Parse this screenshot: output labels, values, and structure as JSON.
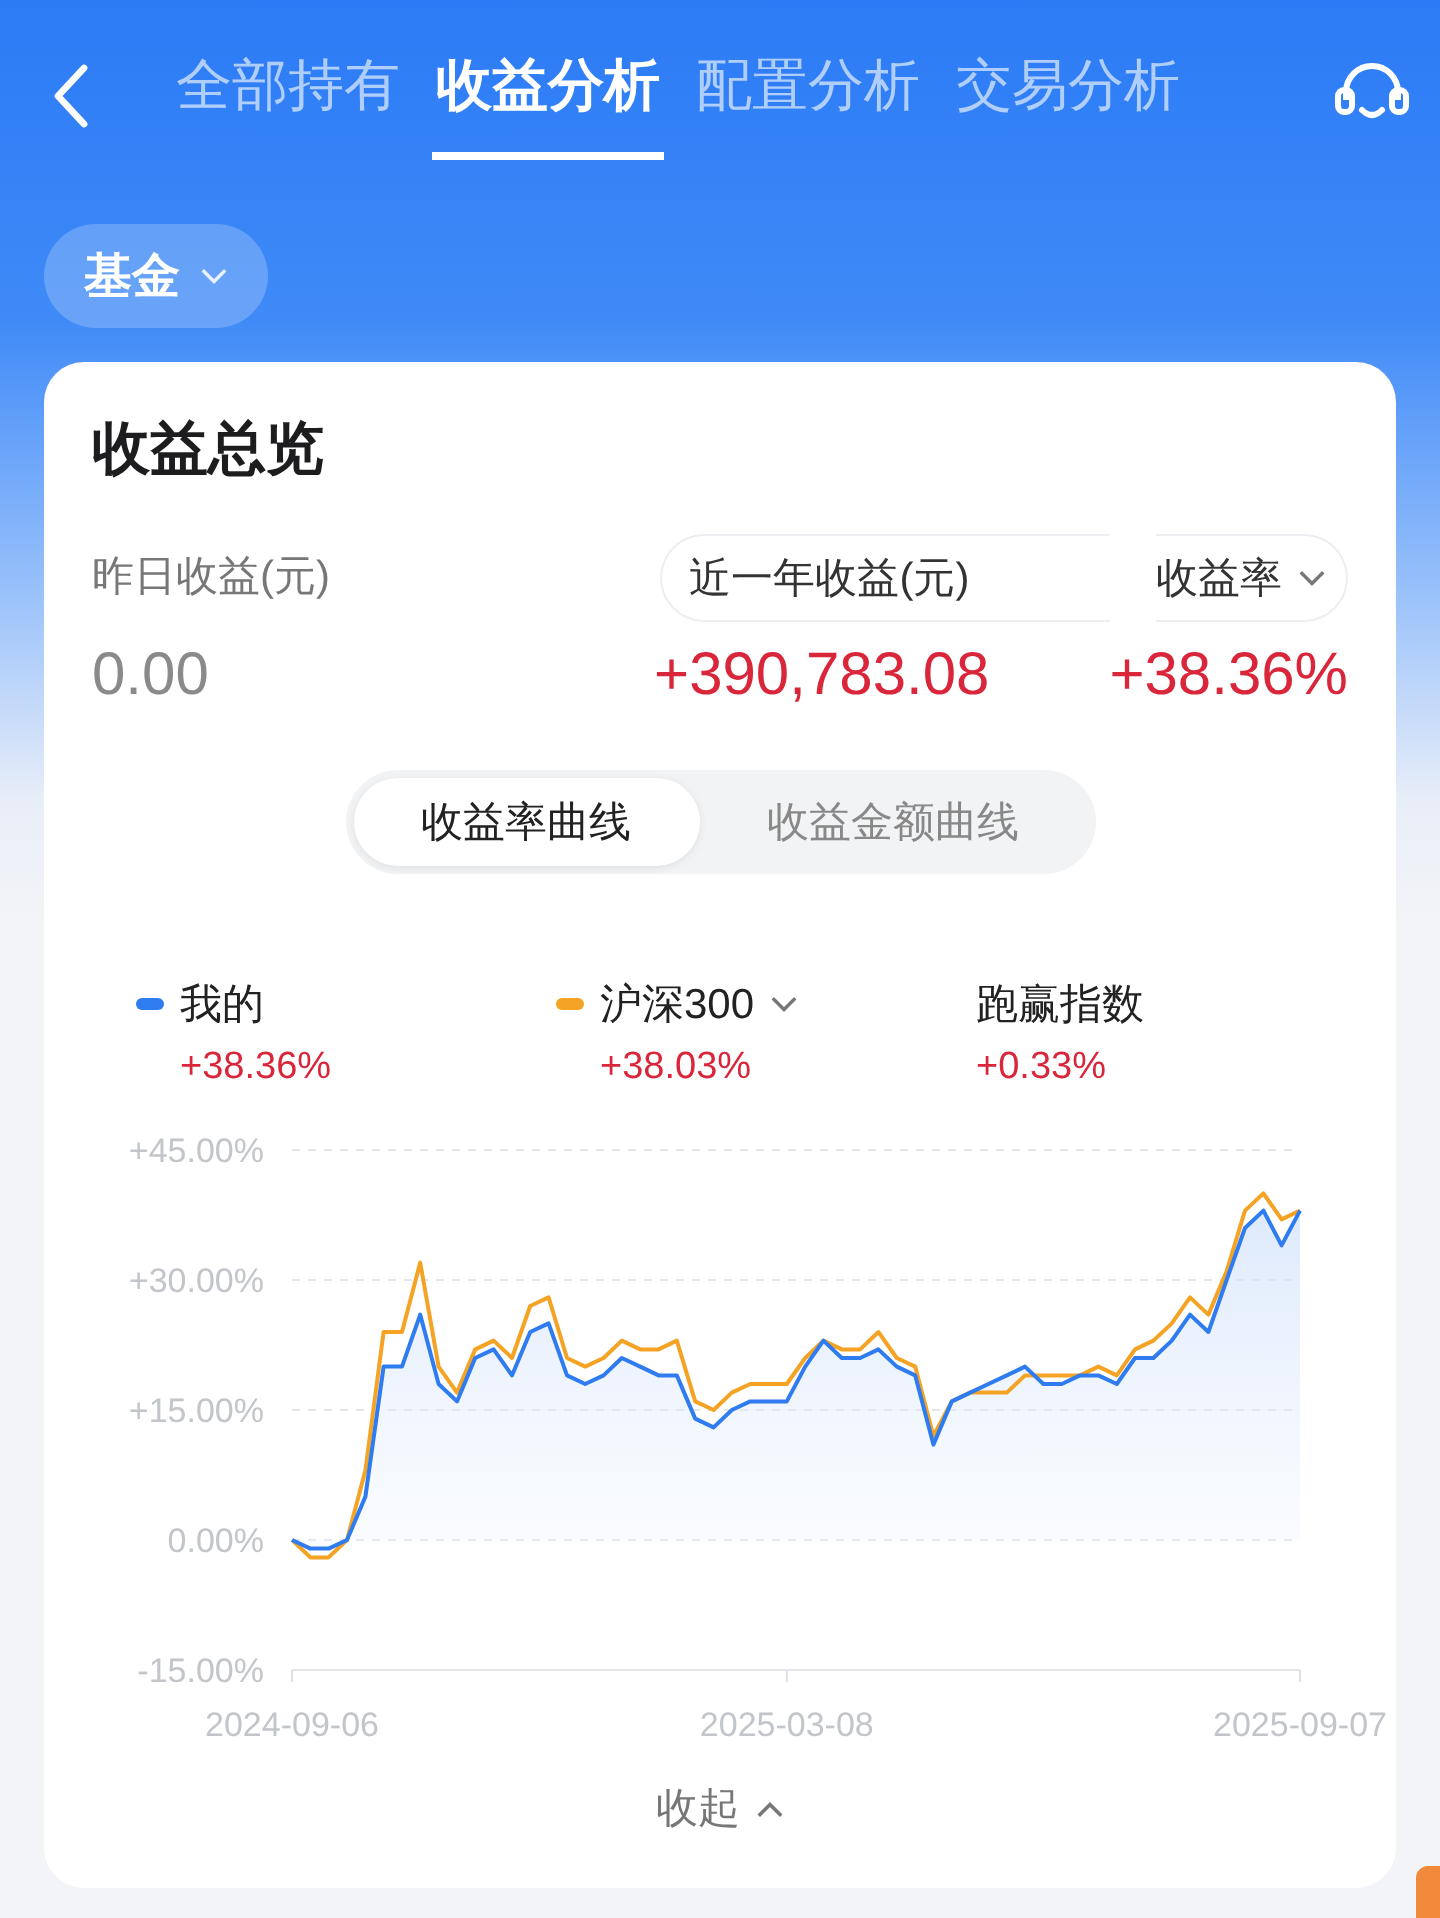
{
  "header": {
    "tabs": [
      {
        "label": "全部持有",
        "selected": false
      },
      {
        "label": "收益分析",
        "selected": true
      },
      {
        "label": "配置分析",
        "selected": false
      },
      {
        "label": "交易分析",
        "selected": false
      }
    ]
  },
  "filter": {
    "label": "基金"
  },
  "overview": {
    "title": "收益总览",
    "stats": [
      {
        "label": "昨日收益(元)",
        "value": "0.00",
        "kind": "plain"
      },
      {
        "label": "近一年收益(元)",
        "value": "+390,783.08",
        "kind": "period"
      },
      {
        "label": "收益率",
        "value": "+38.36%",
        "kind": "dropdown"
      }
    ]
  },
  "curve_tabs": [
    {
      "label": "收益率曲线",
      "selected": true
    },
    {
      "label": "收益金额曲线",
      "selected": false
    }
  ],
  "legend": [
    {
      "value": "+38.36%",
      "kind": "series"
    },
    {
      "value": "+38.03%",
      "kind": "dropdown"
    },
    {
      "name": "跑赢指数",
      "value": "+0.33%",
      "kind": "plain"
    }
  ],
  "chart": {
    "chart_data": {
      "type": "line",
      "grid": true,
      "categories": [
        "2024-09-06",
        null,
        null,
        null,
        null,
        null,
        null,
        null,
        null,
        null,
        null,
        null,
        null,
        null,
        null,
        null,
        null,
        null,
        null,
        null,
        null,
        null,
        null,
        null,
        null,
        null,
        null,
        "2025-03-08",
        null,
        null,
        null,
        null,
        null,
        null,
        null,
        null,
        null,
        null,
        null,
        null,
        null,
        null,
        null,
        null,
        null,
        null,
        null,
        null,
        null,
        null,
        null,
        null,
        null,
        null,
        null,
        "2025-09-07"
      ],
      "series": [
        {
          "name": "我的",
          "type": "area",
          "color": "#2f7cf0",
          "values": [
            0,
            -1,
            -1,
            0,
            5,
            20,
            20,
            26,
            18,
            16,
            21,
            22,
            19,
            24,
            25,
            19,
            18,
            19,
            21,
            20,
            19,
            19,
            14,
            13,
            15,
            16,
            16,
            16,
            20,
            23,
            21,
            21,
            22,
            20,
            19,
            11,
            16,
            17,
            18,
            19,
            20,
            18,
            18,
            19,
            19,
            18,
            21,
            21,
            23,
            26,
            24,
            30,
            36,
            38,
            34,
            38
          ]
        },
        {
          "name": "沪深300",
          "type": "line",
          "color": "#f5a325",
          "values": [
            0,
            -2,
            -2,
            0,
            8,
            24,
            24,
            32,
            20,
            17,
            22,
            23,
            21,
            27,
            28,
            21,
            20,
            21,
            23,
            22,
            22,
            23,
            16,
            15,
            17,
            18,
            18,
            18,
            21,
            23,
            22,
            22,
            24,
            21,
            20,
            12,
            16,
            17,
            17,
            17,
            19,
            19,
            19,
            19,
            20,
            19,
            22,
            23,
            25,
            28,
            26,
            31,
            38,
            40,
            37,
            38
          ]
        }
      ],
      "ylim": [
        -15,
        45
      ],
      "yticks": [
        {
          "value": 45,
          "label": "+45.00%"
        },
        {
          "value": 30,
          "label": "+30.00%"
        },
        {
          "value": 15,
          "label": "+15.00%"
        },
        {
          "value": 0,
          "label": "0.00%"
        },
        {
          "value": -15,
          "label": "-15.00%"
        }
      ]
    }
  },
  "collapse": {
    "label": "收起"
  }
}
